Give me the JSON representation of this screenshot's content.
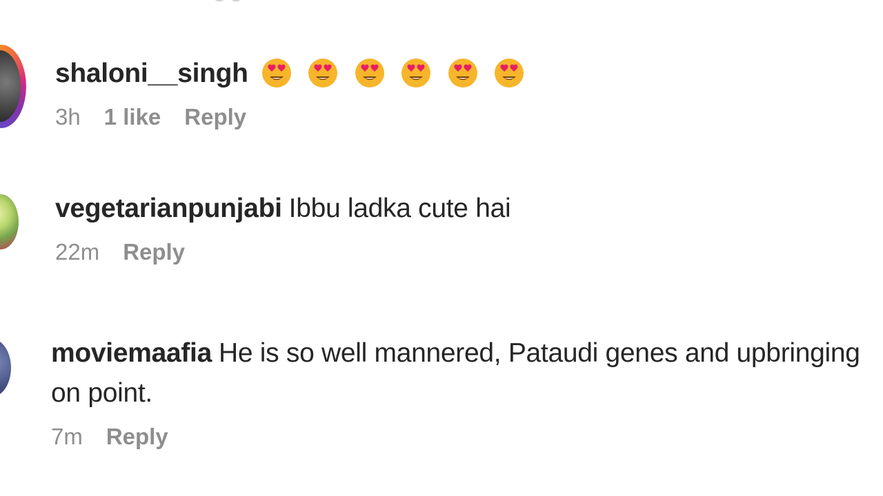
{
  "comments": [
    {
      "username": "shaloni__singh",
      "text": "😍😍😍😍😍😍",
      "time": "3h",
      "likes": "1 like",
      "reply": "Reply"
    },
    {
      "username": "vegetarianpunjabi",
      "text": "Ibbu ladka cute hai",
      "time": "22m",
      "reply": "Reply"
    },
    {
      "username": "moviemaafia",
      "text": "He is so well mannered, Pataudi genes and upbringing on point.",
      "time": "7m",
      "reply": "Reply"
    }
  ],
  "colors": {
    "text": "#262626",
    "meta": "#8e8e8e",
    "story_ring": "#d62976"
  },
  "icons": {
    "emoji": "heart-eyes-face"
  }
}
